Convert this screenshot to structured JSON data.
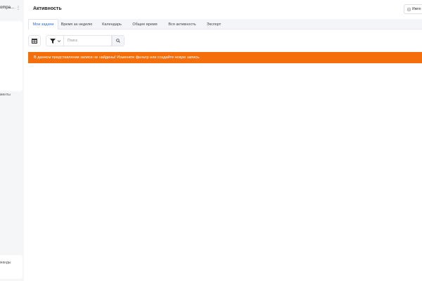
{
  "sidebar": {
    "company_label": "ompa...",
    "more_glyph": "⋮",
    "card_label": "менты",
    "bottom_card_label": "манды"
  },
  "header": {
    "title": "Активность",
    "import_label": "Импо",
    "import_icon": "import-icon"
  },
  "tabs": [
    {
      "label": "Мои задачи",
      "active": true
    },
    {
      "label": "Время за неделю",
      "active": false
    },
    {
      "label": "Календарь",
      "active": false
    },
    {
      "label": "Общее время",
      "active": false
    },
    {
      "label": "Вся активность",
      "active": false
    },
    {
      "label": "Экспорт",
      "active": false
    }
  ],
  "toolbar": {
    "search_placeholder": "Поиск",
    "search_value": ""
  },
  "alert": {
    "text": "В данном представлении записи не найдены! Измените фильтр или создайте новую запись.",
    "color": "#f46f0b"
  },
  "colors": {
    "accent": "#2f6fd6",
    "warning": "#f46f0b"
  }
}
